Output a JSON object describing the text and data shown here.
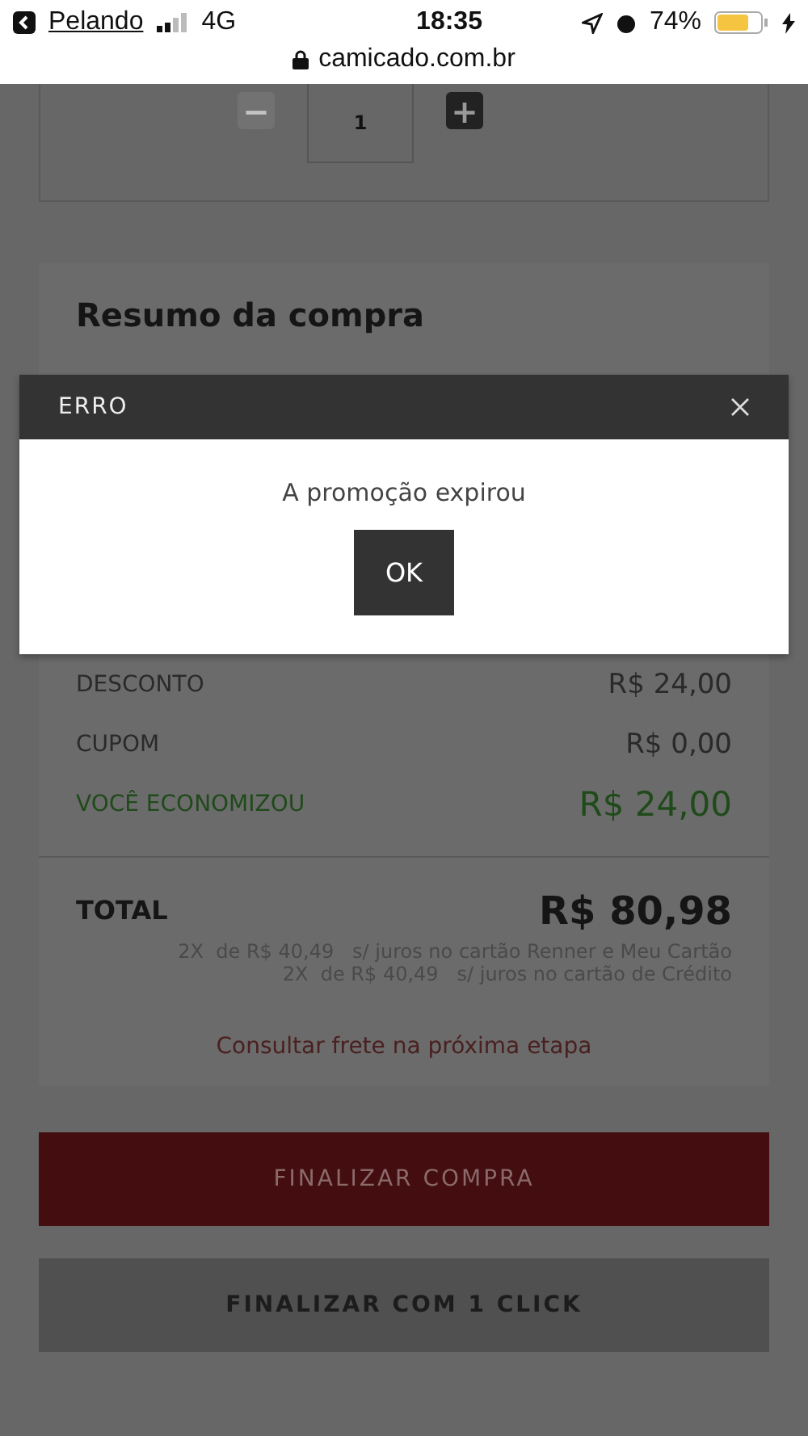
{
  "status_bar": {
    "back_app": "Pelando",
    "network": "4G",
    "time": "18:35",
    "battery": "74%"
  },
  "address_bar": {
    "url": "camicado.com.br"
  },
  "quantity": {
    "decrease": "−",
    "value": "1",
    "increase": "+",
    "decrease_disabled": true
  },
  "summary": {
    "title": "Resumo da compra",
    "rows": [
      {
        "label": "DESCONTO",
        "value": "R$ 24,00",
        "kind": "plain"
      },
      {
        "label": "CUPOM",
        "value": "R$ 0,00",
        "kind": "plain"
      },
      {
        "label": "VOCÊ ECONOMIZOU",
        "value": "R$ 24,00",
        "kind": "savings"
      }
    ],
    "total_label": "TOTAL",
    "total_value": "R$ 80,98",
    "installments": [
      {
        "count": "2X  de R$ 40,49",
        "terms": "s/ juros no cartão Renner e Meu Cartão"
      },
      {
        "count": "2X  de R$ 40,49",
        "terms": "s/ juros no cartão de Crédito"
      }
    ],
    "shipping_link": "Consultar frete na próxima etapa"
  },
  "buttons": [
    {
      "label": "FINALIZAR COMPRA",
      "kind": "primary"
    },
    {
      "label": "FINALIZAR COM 1 CLICK",
      "kind": "secondary"
    }
  ],
  "dialog": {
    "title": "ERRO",
    "message": "A promoção expirou",
    "button": "OK"
  }
}
